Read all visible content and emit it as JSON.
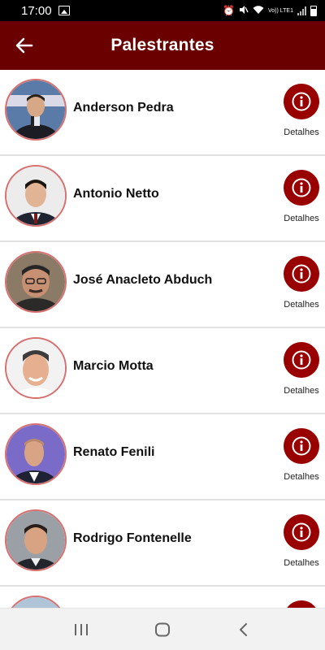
{
  "status_bar": {
    "time": "17:00",
    "icons": [
      "gallery-icon",
      "alarm-icon",
      "mute-icon",
      "wifi-icon",
      "signal-icon",
      "battery-icon"
    ],
    "network_label": "Vo)) LTE1"
  },
  "header": {
    "title": "Palestrantes",
    "back_icon": "arrow-left-icon",
    "background": "#6b0000"
  },
  "speakers": [
    {
      "name": "Anderson Pedra",
      "details_label": "Detalhes"
    },
    {
      "name": "Antonio Netto",
      "details_label": "Detalhes"
    },
    {
      "name": "José Anacleto Abduch",
      "details_label": "Detalhes"
    },
    {
      "name": "Marcio Motta",
      "details_label": "Detalhes"
    },
    {
      "name": "Renato Fenili",
      "details_label": "Detalhes"
    },
    {
      "name": "Rodrigo Fontenelle",
      "details_label": "Detalhes"
    },
    {
      "name": "",
      "details_label": ""
    }
  ],
  "colors": {
    "accent": "#990000",
    "avatar_border": "#d87070"
  },
  "nav_bar": {
    "icons": [
      "recent-apps-icon",
      "home-icon",
      "back-icon"
    ]
  }
}
